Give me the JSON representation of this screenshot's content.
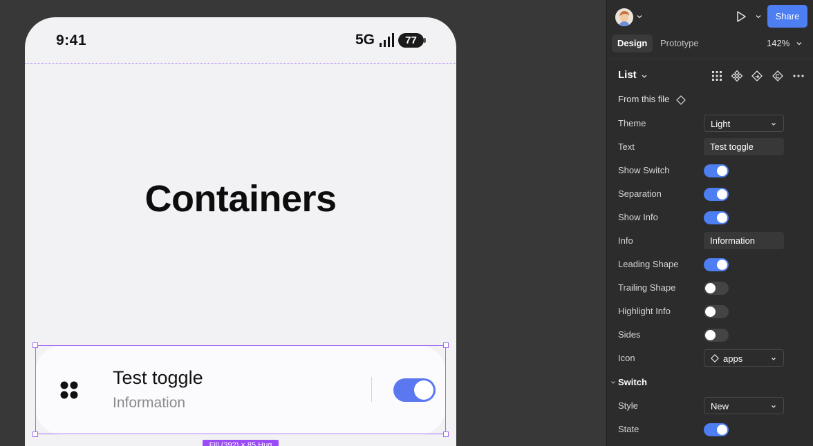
{
  "phone": {
    "status": {
      "time": "9:41",
      "network": "5G",
      "battery": "77"
    },
    "heading": "Containers",
    "list_item": {
      "title": "Test toggle",
      "info": "Information",
      "switch_on": true
    },
    "selection_badge": "Fill (392) × 85 Hug"
  },
  "panel": {
    "share_label": "Share",
    "tabs": {
      "design": "Design",
      "prototype": "Prototype"
    },
    "zoom": "142%",
    "component": {
      "title": "List",
      "from_file": "From this file"
    },
    "props": {
      "theme": {
        "label": "Theme",
        "value": "Light"
      },
      "text": {
        "label": "Text",
        "value": "Test toggle"
      },
      "show_switch": {
        "label": "Show Switch",
        "on": true
      },
      "separation": {
        "label": "Separation",
        "on": true
      },
      "show_info": {
        "label": "Show Info",
        "on": true
      },
      "info": {
        "label": "Info",
        "value": "Information"
      },
      "leading_shape": {
        "label": "Leading Shape",
        "on": true
      },
      "trailing_shape": {
        "label": "Trailing Shape",
        "on": false
      },
      "highlight_info": {
        "label": "Highlight Info",
        "on": false
      },
      "sides": {
        "label": "Sides",
        "on": false
      },
      "icon": {
        "label": "Icon",
        "value": "apps"
      }
    },
    "switch_section": {
      "title": "Switch",
      "style": {
        "label": "Style",
        "value": "New"
      },
      "state": {
        "label": "State",
        "on": true
      }
    }
  },
  "colors": {
    "accent": "#4d7ef2",
    "selection": "#a06cf5",
    "canvas_bg": "#383838",
    "panel_bg": "#2c2c2c",
    "phone_switch": "#5b78f0"
  }
}
